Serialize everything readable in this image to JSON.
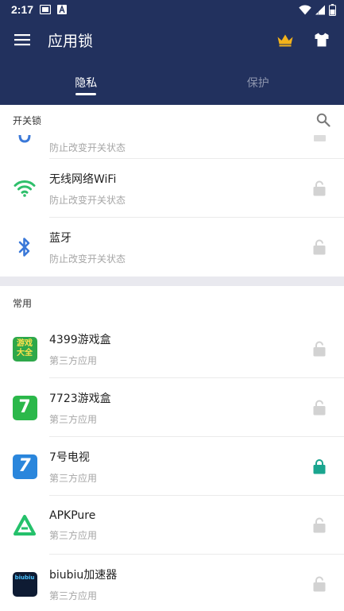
{
  "status_bar": {
    "time": "2:17"
  },
  "app_bar": {
    "title": "应用锁"
  },
  "tabs": [
    {
      "label": "隐私",
      "active": true
    },
    {
      "label": "保护",
      "active": false
    }
  ],
  "sections": {
    "toggle_lock": {
      "header": "开关锁",
      "items": [
        {
          "title": "",
          "subtitle": "防止改变开关状态",
          "locked": false
        },
        {
          "title": "无线网络WiFi",
          "subtitle": "防止改变开关状态",
          "icon": "wifi-icon",
          "locked": false
        },
        {
          "title": "蓝牙",
          "subtitle": "防止改变开关状态",
          "icon": "bluetooth-icon",
          "locked": false
        }
      ]
    },
    "common": {
      "header": "常用",
      "items": [
        {
          "title": "4399游戏盒",
          "subtitle": "第三方应用",
          "icon": "4399-app-icon",
          "icon_text": "游戏大全",
          "locked": false
        },
        {
          "title": "7723游戏盒",
          "subtitle": "第三方应用",
          "icon": "7723-app-icon",
          "icon_text": "7",
          "locked": false
        },
        {
          "title": "7号电视",
          "subtitle": "第三方应用",
          "icon": "7tv-app-icon",
          "icon_text": "7",
          "locked": true
        },
        {
          "title": "APKPure",
          "subtitle": "第三方应用",
          "icon": "apkpure-app-icon",
          "locked": false
        },
        {
          "title": "biubiu加速器",
          "subtitle": "第三方应用",
          "icon": "biubiu-app-icon",
          "icon_text": "biubiu",
          "locked": false
        }
      ]
    }
  },
  "colors": {
    "header_bg": "#22315e",
    "accent_lock": "#1aa58f",
    "unlocked_gray": "#d2d2d2",
    "crown": "#f3b21b"
  }
}
